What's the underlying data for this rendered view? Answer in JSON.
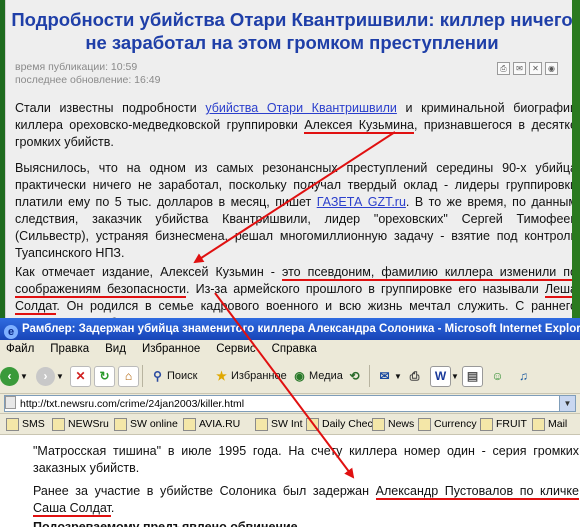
{
  "article": {
    "headline": "Подробности убийства Отари Квантришвили: киллер ничего не заработал на этом громком преступлении",
    "pub_time": "время публикации: 10:59",
    "updated": "последнее обновление: 16:49",
    "p1": {
      "pre": "Стали известны подробности ",
      "link": "убийства Отари Квантришвили",
      "mid": " и криминальной биографии киллера ореховско-медведковской группировки ",
      "underlined": "Алексея Кузьмина",
      "post": ", признавшегося в десятке громких убийств."
    },
    "p2": {
      "pre": "Выяснилось, что на одном из самых резонансных преступлений середины 90-х убийца практически ничего не заработал, поскольку получал твердый оклад - лидеры группировки платили ему по 5 тыс. долларов в месяц, пишет ",
      "link": "ГАЗЕТА GZT.ru",
      "post": ". В то же время, по данным следствия, заказчик убийства Квантришвили, лидер \"ореховских\" Сергей Тимофеев (Сильвестр), устраняя бизнесмена, решал многомиллионную задачу - взятие под контроль Туапсинского НПЗ."
    },
    "p3": {
      "pre": "Как отмечает издание, Алексей Кузьмин - ",
      "underlined": "это псевдоним, фамилию киллера изменили по соображениям безопасности",
      "mid": ". Из-за армейского прошлого в группировке его называли ",
      "underlined2": "Леша Солдат",
      "post": ". Он родился в семье кадрового военного и всю жизнь мечтал служить. С раннего возраста умел обращаться с оружием, а по окончании школы поступил в военное"
    }
  },
  "browser": {
    "title": "Рамблер: Задержан убийца знаменитого киллера Александра Солоника - Microsoft Internet Explorer",
    "menu": [
      "Файл",
      "Правка",
      "Вид",
      "Избранное",
      "Сервис",
      "Справка"
    ],
    "toolbar": {
      "search": "Поиск",
      "favorites": "Избранное",
      "media": "Медиа"
    },
    "address": "http://txt.newsru.com/crime/24jan2003/killer.html",
    "links": [
      "SMS",
      "NEWSru",
      "SW online",
      "AVIA.RU",
      "SW Int",
      "Daily Check",
      "News",
      "Currency",
      "FRUIT",
      "Mail"
    ],
    "content": {
      "line1": "\"Матросская тишина\" в июле 1995 года. На счету киллера номер один - серия громких заказных убийств.",
      "line2_pre": "Ранее за участие в убийстве Солоника был задержан ",
      "line2_underlined": "Александр Пустовалов по кличке Саша Солдат",
      "line2_post": ".",
      "line3": "Подозреваемому предъявлено обвинение"
    }
  }
}
